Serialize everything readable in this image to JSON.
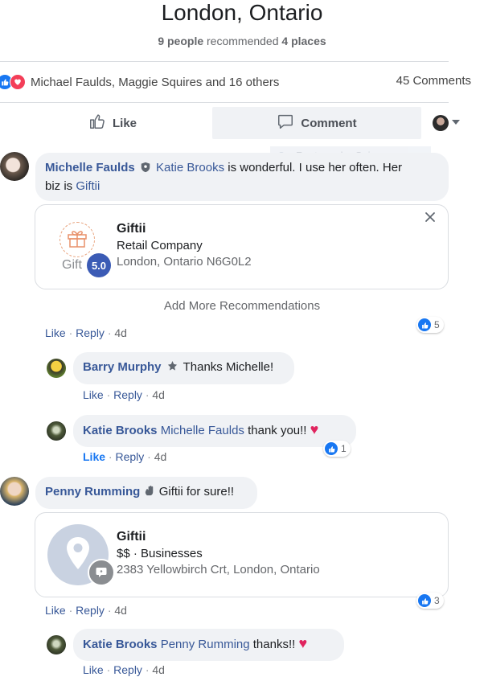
{
  "header": {
    "title": "London, Ontario",
    "subtitle_count": "9 people",
    "subtitle_mid": " recommended ",
    "subtitle_places": "4 places"
  },
  "reactions": {
    "names": "Michael Faulds, Maggie Squires and 16 others",
    "comments_count": "45 Comments"
  },
  "actions": {
    "like_label": "Like",
    "comment_label": "Comment"
  },
  "ghost_tooltip": "Rectangular Snip",
  "comments": [
    {
      "author": "Michelle Faulds",
      "tag": "Katie Brooks",
      "text_before": " is wonderful. I use her often. Her",
      "text_line2_prefix": "biz is ",
      "link": "Giftii",
      "card": {
        "title": "Giftii",
        "category": "Retail Company",
        "address": "London, Ontario N6G0L2",
        "logo_text": "Gift",
        "rating": "5.0"
      },
      "like": "Like",
      "reply": "Reply",
      "time": "4d",
      "reaction_count": "5"
    },
    {
      "author": "Barry Murphy",
      "text": " Thanks Michelle!",
      "like": "Like",
      "reply": "Reply",
      "time": "4d"
    },
    {
      "author": "Katie Brooks",
      "tag": "Michelle Faulds",
      "text": " thank you!!",
      "like": "Like",
      "reply": "Reply",
      "time": "4d",
      "reaction_count": "1"
    },
    {
      "author": "Penny Rumming",
      "text": " Giftii for sure!!",
      "card": {
        "title": "Giftii",
        "price": "$$ · Businesses",
        "address": "2383 Yellowbirch Crt, London, Ontario"
      },
      "like": "Like",
      "reply": "Reply",
      "time": "4d",
      "reaction_count": "3"
    },
    {
      "author": "Katie Brooks",
      "tag": "Penny Rumming",
      "text": " thanks!!",
      "like": "Like",
      "reply": "Reply",
      "time": "4d"
    }
  ],
  "add_more": "Add More Recommendations",
  "colors": {
    "link_blue": "#385898",
    "like_blue": "#1877f2",
    "love_red": "#f33e58",
    "bubble_bg": "#f0f2f5"
  }
}
